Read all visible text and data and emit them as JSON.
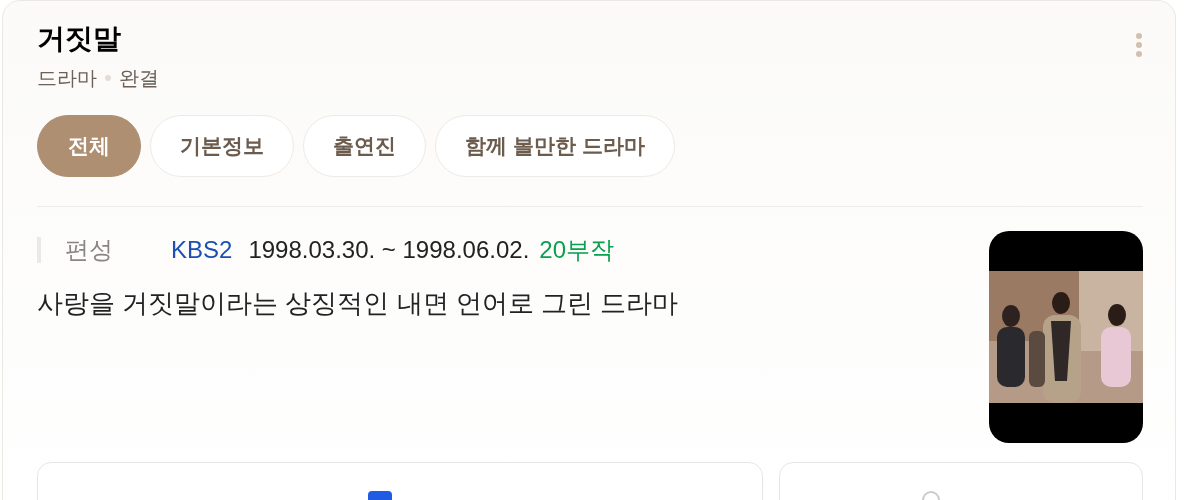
{
  "title": "거짓말",
  "subtitle": {
    "genre": "드라마",
    "status": "완결"
  },
  "tabs": [
    {
      "label": "전체",
      "selected": true
    },
    {
      "label": "기본정보",
      "selected": false
    },
    {
      "label": "출연진",
      "selected": false
    },
    {
      "label": "함께 볼만한 드라마",
      "selected": false
    }
  ],
  "info": {
    "label": "편성",
    "channel": "KBS2",
    "period": "1998.03.30. ~ 1998.06.02.",
    "episodes": "20부작"
  },
  "description": "사랑을 거짓말이라는 상징적인 내면 언어로 그린 드라마"
}
